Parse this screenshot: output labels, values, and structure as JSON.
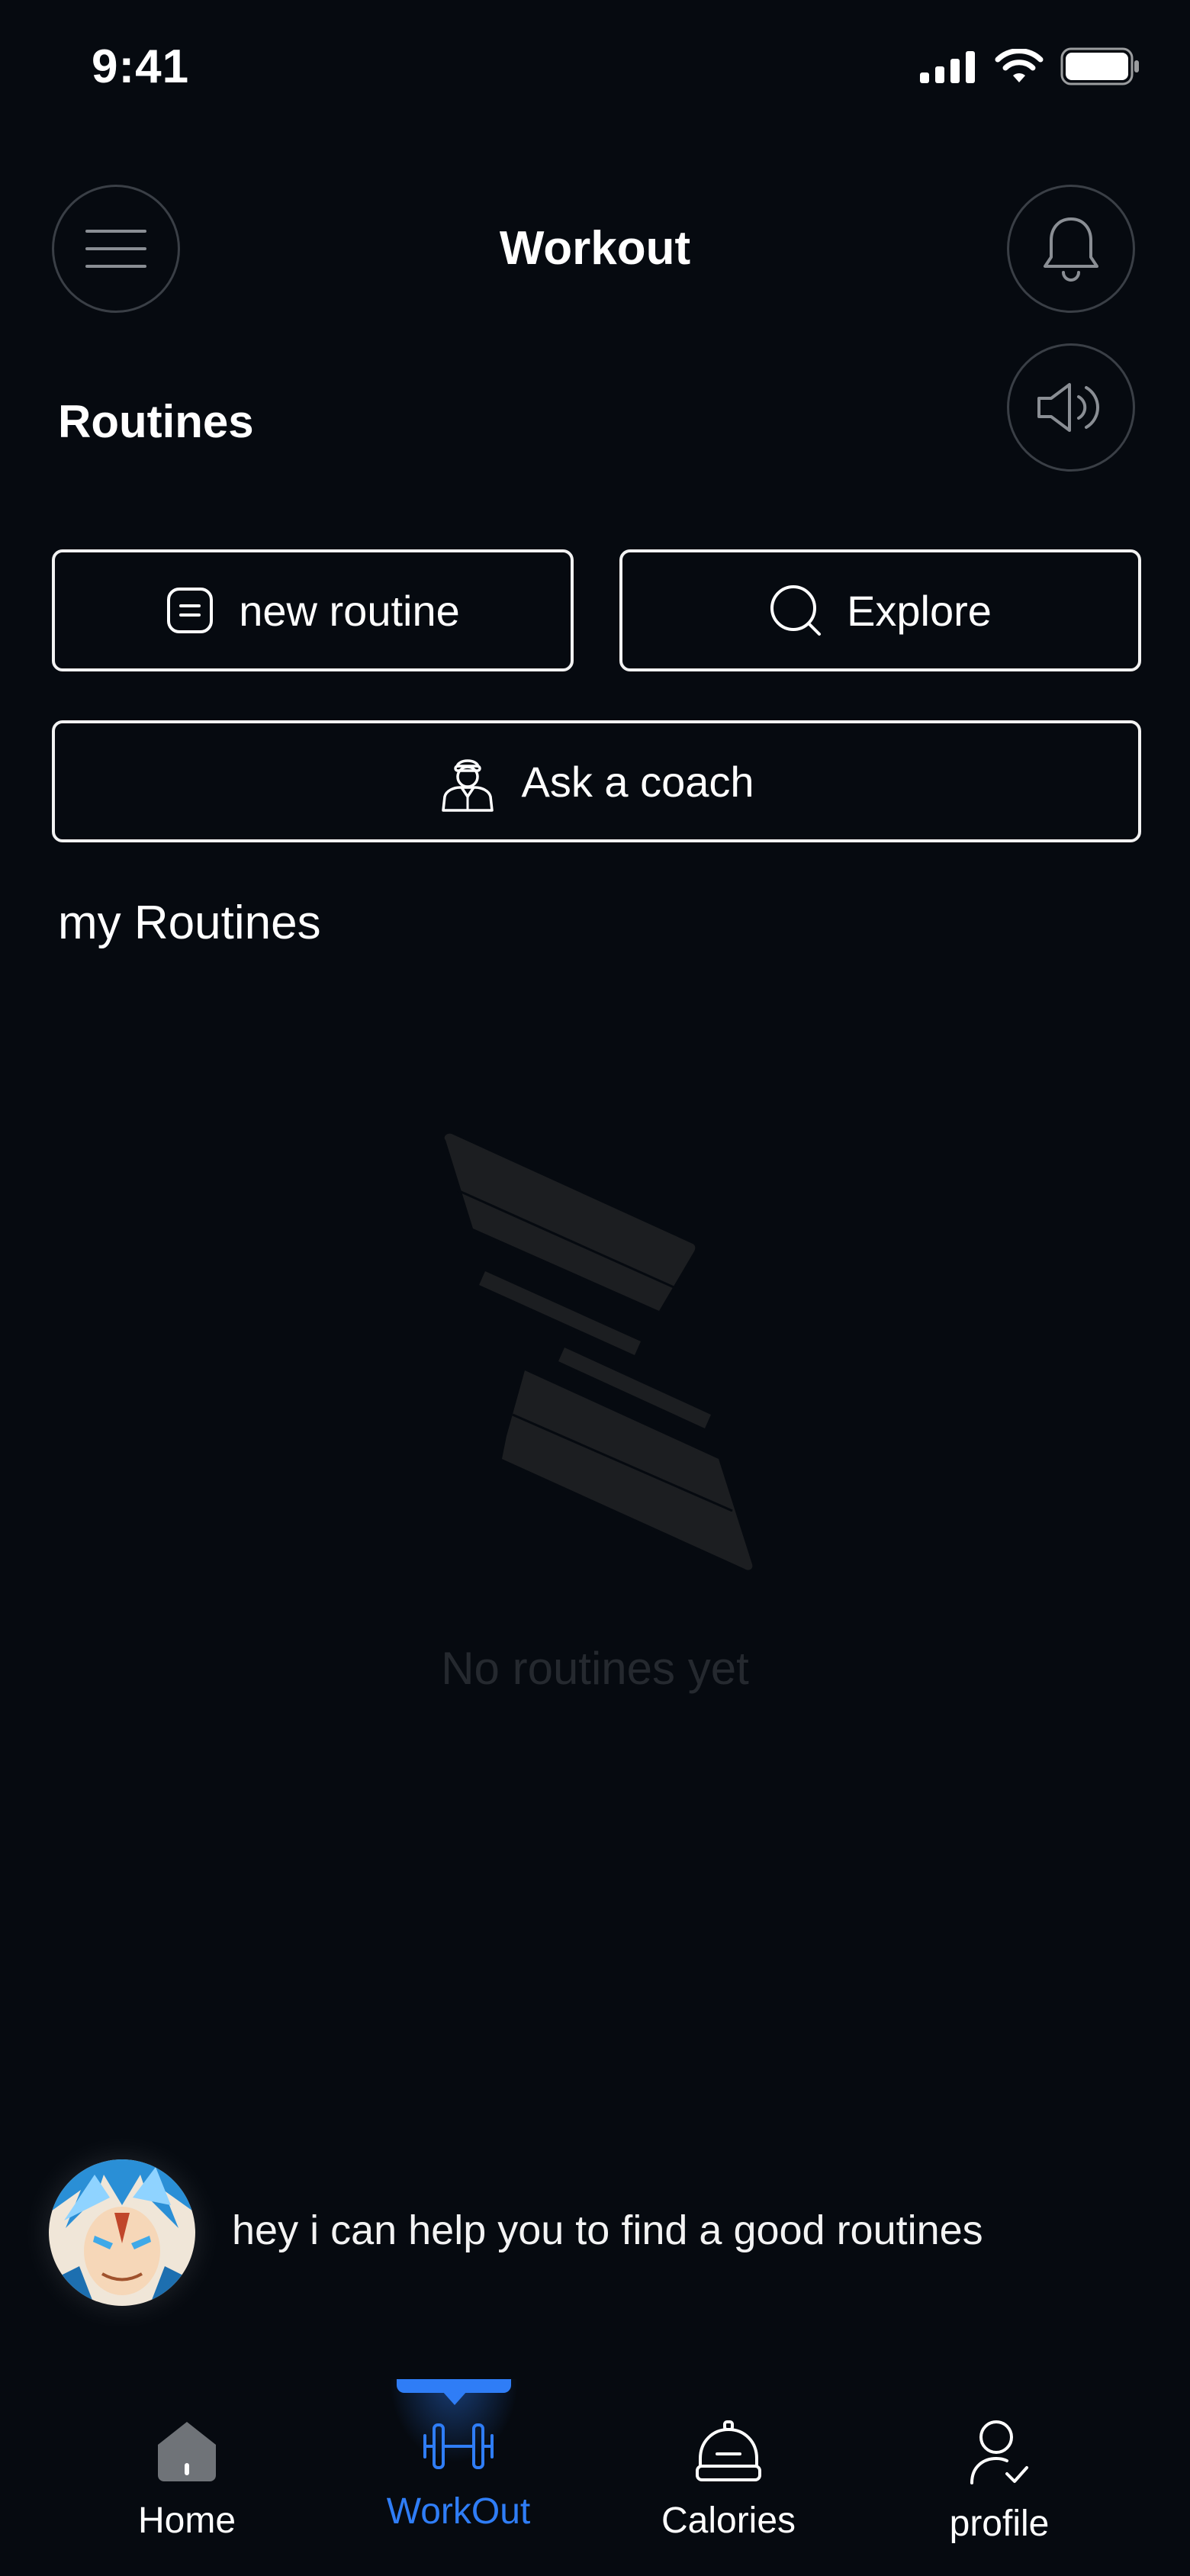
{
  "status_bar": {
    "time": "9:41"
  },
  "header": {
    "title": "Workout"
  },
  "section": {
    "title": "Routines"
  },
  "actions": {
    "new_routine": "new routine",
    "explore": "Explore",
    "ask_coach": "Ask a coach"
  },
  "my_routines": {
    "title": "my Routines",
    "empty_text": "No routines yet"
  },
  "coach": {
    "message": "hey i can help you to find a good routines"
  },
  "nav": {
    "items": [
      {
        "label": "Home",
        "icon": "home-icon"
      },
      {
        "label": "WorkOut",
        "icon": "dumbbell-icon",
        "active": true
      },
      {
        "label": "Calories",
        "icon": "food-cloche-icon"
      },
      {
        "label": "profile",
        "icon": "user-check-icon"
      }
    ]
  },
  "colors": {
    "background": "#060a10",
    "accent": "#2f7df6",
    "border": "#f2f2f2",
    "muted": "#25292f"
  }
}
